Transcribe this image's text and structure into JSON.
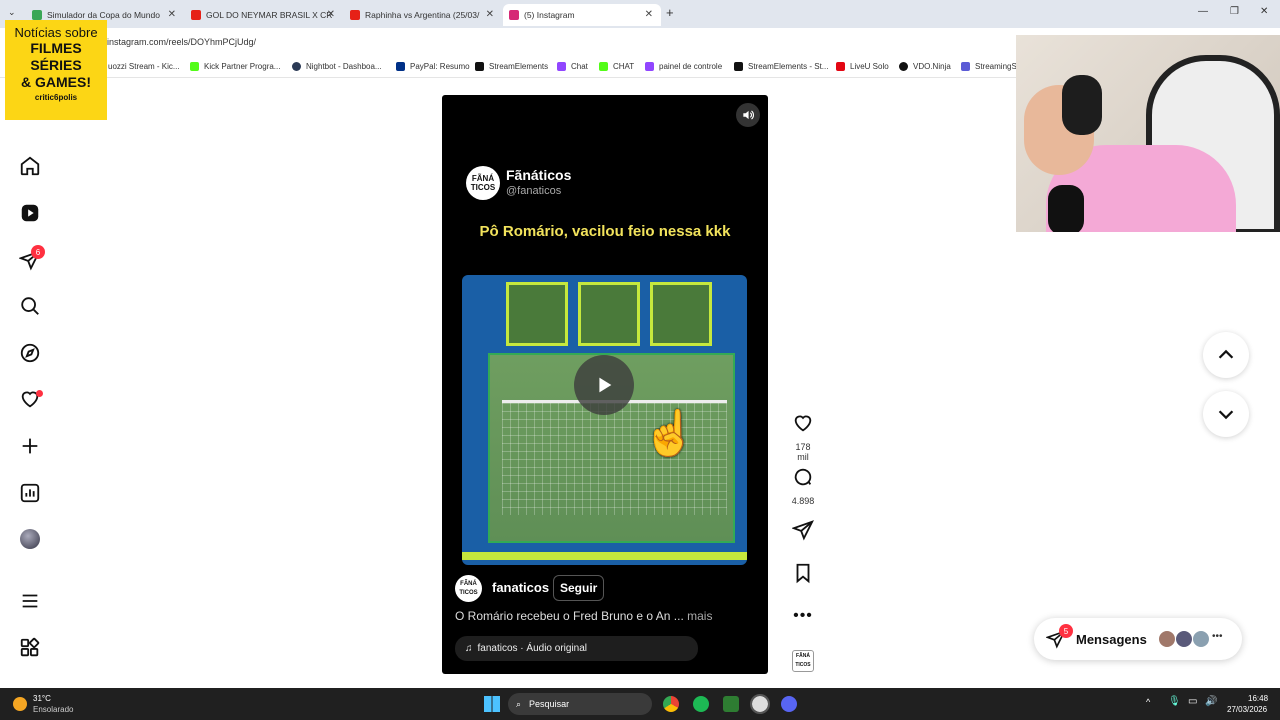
{
  "tabs": [
    {
      "title": "Simulador da Copa do Mundo",
      "color": "#3aa757",
      "active": false
    },
    {
      "title": "GOL DO NEYMAR BRASIL X CR",
      "color": "#e62117",
      "active": false
    },
    {
      "title": "Raphinha vs Argentina (25/03/",
      "color": "#e62117",
      "active": false
    },
    {
      "title": "(5) Instagram",
      "color": "#d62976",
      "active": true
    }
  ],
  "address": {
    "url": "instagram.com/reels/DOYhmPCjUdg/"
  },
  "bookmarks": [
    {
      "label": "uozzi Stream - Kic...",
      "color": "#53fc18"
    },
    {
      "label": "Kick Partner Progra...",
      "color": "#53fc18"
    },
    {
      "label": "Nightbot - Dashboa...",
      "color": "#2b3a55"
    },
    {
      "label": "PayPal: Resumo",
      "color": "#003087"
    },
    {
      "label": "StreamElements",
      "color": "#111111"
    },
    {
      "label": "Chat",
      "color": "#9146ff"
    },
    {
      "label": "CHAT",
      "color": "#53fc18"
    },
    {
      "label": "painel de controle",
      "color": "#9146ff"
    },
    {
      "label": "StreamElements - St...",
      "color": "#111111"
    },
    {
      "label": "LiveU Solo",
      "color": "#e30613"
    },
    {
      "label": "VDO.Ninja",
      "color": "#111111"
    },
    {
      "label": "StreamingS",
      "color": "#5b5bd6"
    }
  ],
  "promo": {
    "line1": "Notícias sobre",
    "line2": "FILMES",
    "line3": "SÉRIES",
    "line4": "& GAMES!",
    "brand": "critic6polis"
  },
  "sidebar": {
    "notification_badge": "6"
  },
  "reel": {
    "page_name": "Fãnáticos",
    "page_handle": "@fanaticos",
    "logo_text": "FÃNÁ TICOS",
    "caption": "Pô Romário, vacilou feio nessa kkk",
    "author": "fanaticos",
    "follow_label": "Seguir",
    "description": "O Romário recebeu o Fred Bruno e o An ...",
    "more_label": "mais",
    "audio": "fanaticos · Áudio original"
  },
  "actions": {
    "likes": "178 mil",
    "comments": "4.898"
  },
  "messages": {
    "label": "Mensagens",
    "badge": "5"
  },
  "taskbar": {
    "temp": "31°C",
    "weather": "Ensolarado",
    "search": "Pesquisar",
    "time": "16:48",
    "date": "27/03/2026"
  },
  "colors": {
    "accent_badge": "#ff3040",
    "caption_yellow": "#f2e35c",
    "promo_yellow": "#fcd615"
  }
}
